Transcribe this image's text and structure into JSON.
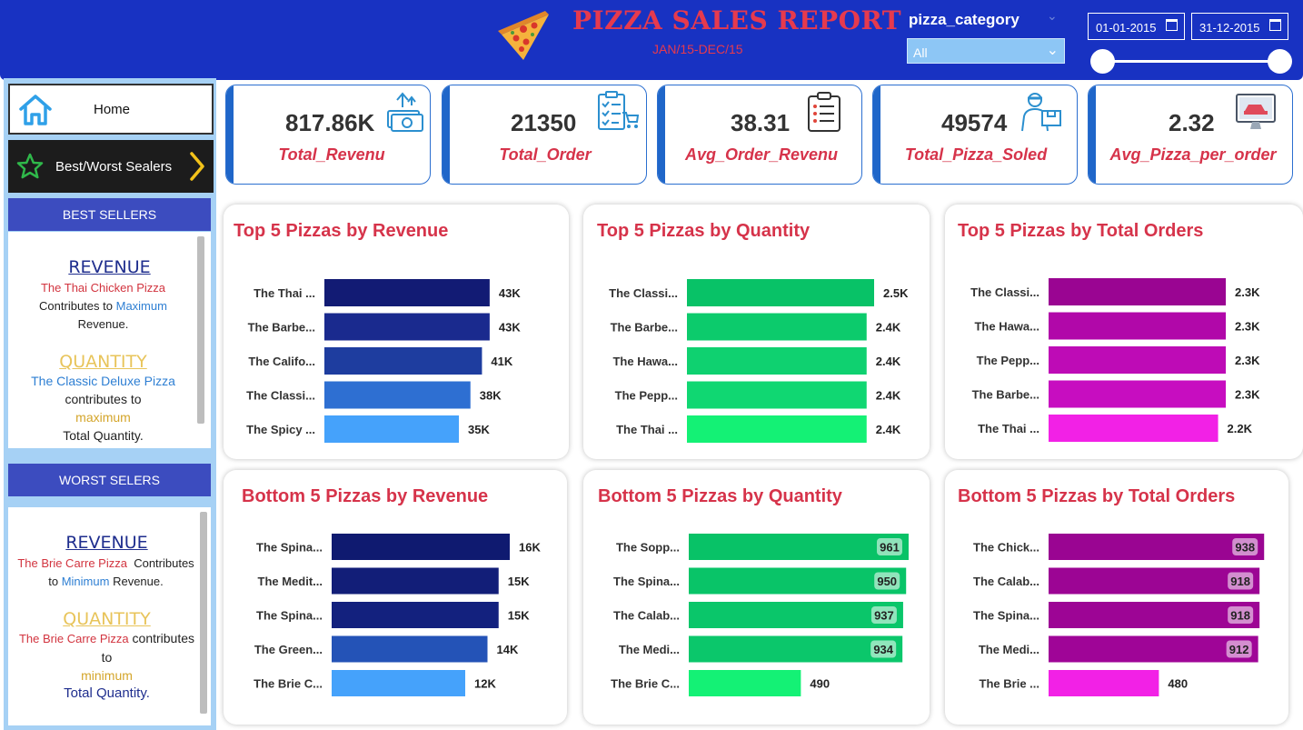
{
  "header": {
    "title": "PIZZA SALES REPORT",
    "subtitle": "JAN/15-DEC/15",
    "filter_label": "pizza_category",
    "filter_value": "All",
    "date_from": "01-01-2015",
    "date_to": "31-12-2015"
  },
  "sidebar": {
    "home_label": "Home",
    "best_worst_label": "Best/Worst Sealers",
    "best_sellers": {
      "header": "BEST SELLERS",
      "revenue_title": "REVENUE",
      "revenue_pizza": "The Thai Chicken Pizza",
      "revenue_contributes": "Contributes to",
      "revenue_maximum": "Maximum",
      "revenue_word": "Revenue.",
      "quantity_title": "QUANTITY",
      "quantity_pizza": "The Classic Deluxe Pizza",
      "quantity_contributes": "contributes to",
      "quantity_maximum": "maximum",
      "quantity_word": "Total Quantity."
    },
    "worst_sellers": {
      "header": "WORST SELERS",
      "revenue_title": "REVENUE",
      "revenue_pizza": "The Brie Carre Pizza",
      "revenue_contributes": "Contributes",
      "revenue_to": "to",
      "revenue_minimum": "Minimum",
      "revenue_word": "Revenue.",
      "quantity_title": "QUANTITY",
      "quantity_pizza": "The Brie Carre Pizza",
      "quantity_contributes": "contributes",
      "quantity_to": "to",
      "quantity_minimum": "minimum",
      "quantity_word": "Total Quantity."
    }
  },
  "kpis": [
    {
      "value": "817.86K",
      "label": "Total_Revenu",
      "icon": "money-icon"
    },
    {
      "value": "21350",
      "label": "Total_Order",
      "icon": "clipboard-cart-icon"
    },
    {
      "value": "38.31",
      "label": "Avg_Order_Revenu",
      "icon": "checklist-icon"
    },
    {
      "value": "49574",
      "label": "Total_Pizza_Soled",
      "icon": "delivery-icon"
    },
    {
      "value": "2.32",
      "label": "Avg_Pizza_per_order",
      "icon": "monitor-icon"
    }
  ],
  "chart_data": [
    {
      "type": "bar",
      "title": "Top 5 Pizzas by Revenue",
      "categories": [
        "The Thai ...",
        "The Barbe...",
        "The Califo...",
        "The Classi...",
        "The Spicy ..."
      ],
      "values": [
        43,
        43,
        41,
        38,
        35
      ],
      "value_labels": [
        "43K",
        "43K",
        "41K",
        "38K",
        "35K"
      ],
      "colors": [
        "#121b74",
        "#1a2a8e",
        "#1e3d9f",
        "#2e6fd2",
        "#45a2fb"
      ]
    },
    {
      "type": "bar",
      "title": "Top 5 Pizzas by Quantity",
      "categories": [
        "The Classi...",
        "The Barbe...",
        "The Hawa...",
        "The Pepp...",
        "The Thai ..."
      ],
      "values": [
        2.5,
        2.4,
        2.4,
        2.4,
        2.4
      ],
      "value_labels": [
        "2.5K",
        "2.4K",
        "2.4K",
        "2.4K",
        "2.4K"
      ],
      "colors": [
        "#08c267",
        "#0ccb6c",
        "#0fd170",
        "#10d772",
        "#14f175"
      ]
    },
    {
      "type": "bar",
      "title": "Top 5 Pizzas by Total Orders",
      "categories": [
        "The Classi...",
        "The Hawa...",
        "The Pepp...",
        "The Barbe...",
        "The Thai ..."
      ],
      "values": [
        2.3,
        2.3,
        2.3,
        2.3,
        2.2
      ],
      "value_labels": [
        "2.3K",
        "2.3K",
        "2.3K",
        "2.3K",
        "2.2K"
      ],
      "colors": [
        "#9a0592",
        "#b108a9",
        "#be0bb6",
        "#c70dc0",
        "#f221e6"
      ]
    },
    {
      "type": "bar",
      "title": "Bottom 5 Pizzas by Revenue",
      "categories": [
        "The Spina...",
        "The Medit...",
        "The Spina...",
        "The Green...",
        "The Brie C..."
      ],
      "values": [
        16,
        15,
        15,
        14,
        12
      ],
      "value_labels": [
        "16K",
        "15K",
        "15K",
        "14K",
        "12K"
      ],
      "colors": [
        "#0f1a70",
        "#121e78",
        "#13217e",
        "#2453b7",
        "#45a2fb"
      ]
    },
    {
      "type": "bar",
      "title": "Bottom 5 Pizzas by Quantity",
      "categories": [
        "The Sopp...",
        "The Spina...",
        "The Calab...",
        "The Medi...",
        "The Brie C..."
      ],
      "values": [
        961,
        950,
        937,
        934,
        490
      ],
      "value_labels": [
        "961",
        "950",
        "937",
        "934",
        "490"
      ],
      "colors": [
        "#08c267",
        "#09c468",
        "#0ac66a",
        "#0bc76b",
        "#14f175"
      ]
    },
    {
      "type": "bar",
      "title": "Bottom 5 Pizzas by Total Orders",
      "categories": [
        "The Chick...",
        "The Calab...",
        "The Spina...",
        "The Medi...",
        "The Brie ..."
      ],
      "values": [
        938,
        918,
        918,
        912,
        480
      ],
      "value_labels": [
        "938",
        "918",
        "918",
        "912",
        "480"
      ],
      "colors": [
        "#9a0592",
        "#9c0594",
        "#9d0595",
        "#9f0597",
        "#f221e6"
      ]
    }
  ]
}
